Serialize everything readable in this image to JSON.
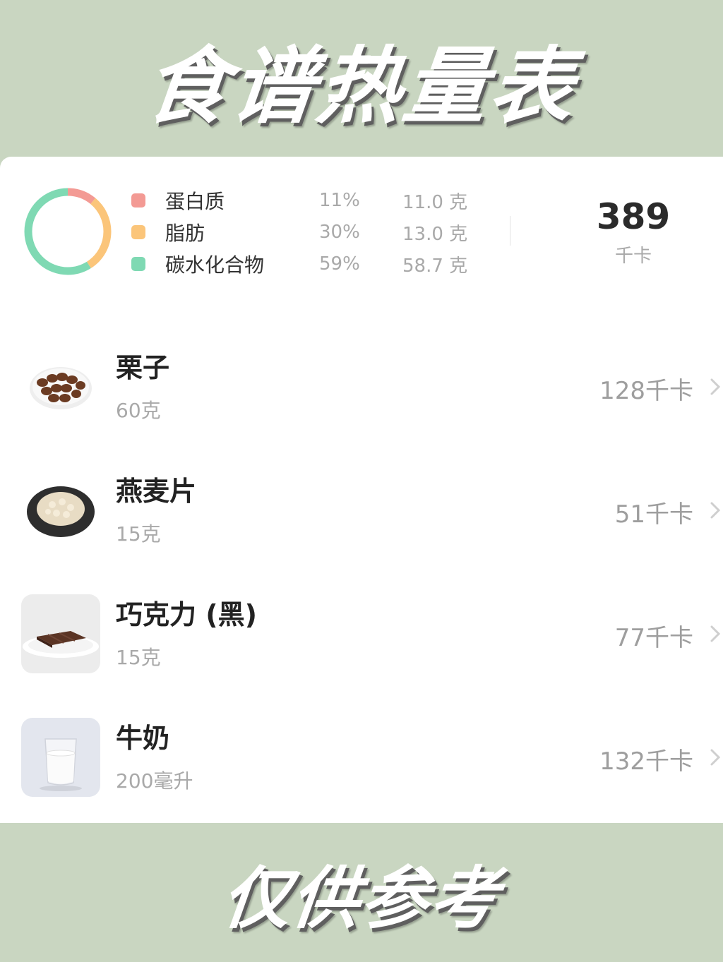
{
  "header": {
    "title": "食谱热量表"
  },
  "summary": {
    "macros": [
      {
        "name": "蛋白质",
        "percent": "11%",
        "grams": "11.0 克",
        "color": "#f39a94"
      },
      {
        "name": "脂肪",
        "percent": "30%",
        "grams": "13.0 克",
        "color": "#fbc57a"
      },
      {
        "name": "碳水化合物",
        "percent": "59%",
        "grams": "58.7 克",
        "color": "#7fd9b3"
      }
    ],
    "donut_fractions": [
      0.11,
      0.3,
      0.59
    ],
    "total_kcal": "389",
    "kcal_unit": "千卡"
  },
  "foods": [
    {
      "name": "栗子",
      "amount": "60克",
      "kcal": "128千卡",
      "icon": "chestnut-plate-icon"
    },
    {
      "name": "燕麦片",
      "amount": "15克",
      "kcal": "51千卡",
      "icon": "oatmeal-plate-icon"
    },
    {
      "name": "巧克力 (黑)",
      "amount": "15克",
      "kcal": "77千卡",
      "icon": "chocolate-plate-icon"
    },
    {
      "name": "牛奶",
      "amount": "200毫升",
      "kcal": "132千卡",
      "icon": "milk-glass-icon"
    }
  ],
  "footer": {
    "text": "仅供参考"
  }
}
